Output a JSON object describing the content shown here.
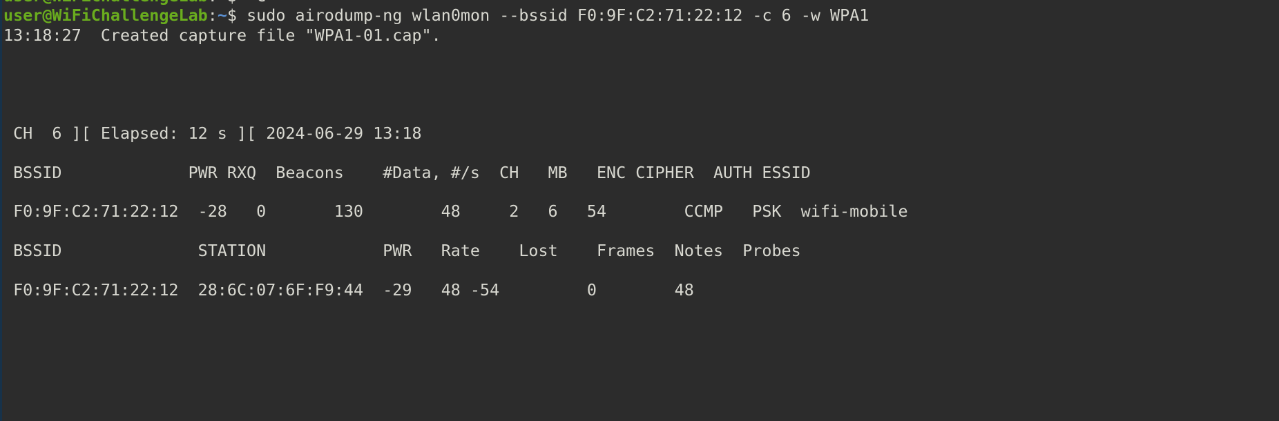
{
  "window": {
    "type": "terminal",
    "background": "#2c2c2c",
    "prompt_color": "#6aad1e",
    "path_color": "#5b8fd0",
    "text_color": "#d8d8d0"
  },
  "prompt": {
    "user_host": "user@WiFiChallengeLab",
    "colon": ":",
    "path": "~",
    "symbol": "$"
  },
  "history": {
    "previous_command": " ^C",
    "command": " sudo airodump-ng wlan0mon --bssid F0:9F:C2:71:22:12 -c 6 -w WPA1",
    "capture_message": "13:18:27  Created capture file \"WPA1-01.cap\"."
  },
  "airodump": {
    "status_line": " CH  6 ][ Elapsed: 12 s ][ 2024-06-29 13:18",
    "ap_header": {
      "bssid": " BSSID",
      "pwr": "PWR",
      "rxq": "RXQ",
      "beacons": "Beacons",
      "data": "#Data,",
      "data_rate": "#/s",
      "ch": "CH",
      "mb": "MB",
      "enc": "ENC",
      "cipher": "CIPHER",
      "auth": "AUTH",
      "essid": "ESSID"
    },
    "access_points": [
      {
        "bssid": "F0:9F:C2:71:22:12",
        "pwr": "-28",
        "rxq": "0",
        "beacons": "130",
        "data": "48",
        "data_rate": "2",
        "ch": "6",
        "mb": "54",
        "enc": "",
        "cipher": "CCMP",
        "auth": "PSK",
        "essid": "wifi-mobile"
      }
    ],
    "station_header": {
      "bssid": " BSSID",
      "station": "STATION",
      "pwr": "PWR",
      "rate": "Rate",
      "lost": "Lost",
      "frames": "Frames",
      "notes": "Notes",
      "probes": "Probes"
    },
    "stations": [
      {
        "bssid": "F0:9F:C2:71:22:12",
        "station": "28:6C:07:6F:F9:44",
        "pwr": "-29",
        "rate": "48 -54",
        "lost": "0",
        "frames": "48",
        "notes": "",
        "probes": ""
      }
    ]
  }
}
